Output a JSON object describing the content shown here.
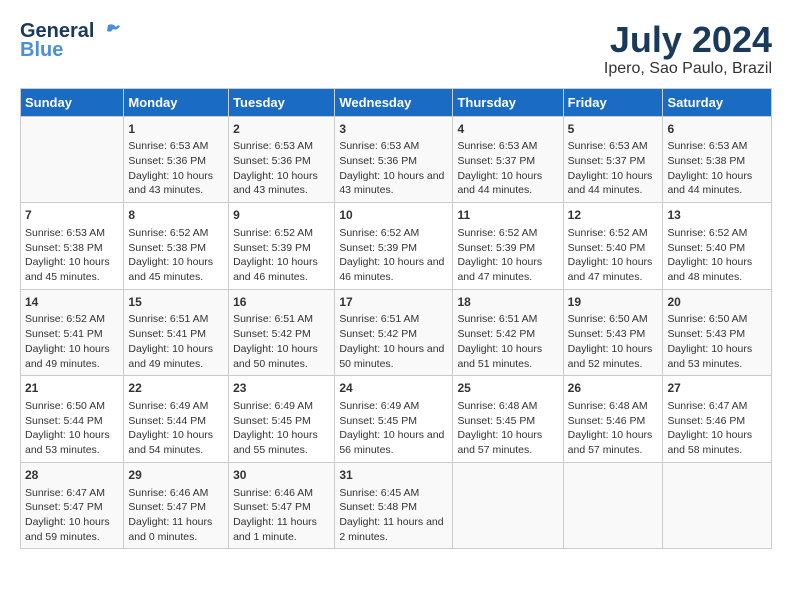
{
  "header": {
    "logo_general": "General",
    "logo_blue": "Blue",
    "month_year": "July 2024",
    "location": "Ipero, Sao Paulo, Brazil"
  },
  "days_of_week": [
    "Sunday",
    "Monday",
    "Tuesday",
    "Wednesday",
    "Thursday",
    "Friday",
    "Saturday"
  ],
  "weeks": [
    [
      {
        "day": "",
        "sunrise": "",
        "sunset": "",
        "daylight": ""
      },
      {
        "day": "1",
        "sunrise": "Sunrise: 6:53 AM",
        "sunset": "Sunset: 5:36 PM",
        "daylight": "Daylight: 10 hours and 43 minutes."
      },
      {
        "day": "2",
        "sunrise": "Sunrise: 6:53 AM",
        "sunset": "Sunset: 5:36 PM",
        "daylight": "Daylight: 10 hours and 43 minutes."
      },
      {
        "day": "3",
        "sunrise": "Sunrise: 6:53 AM",
        "sunset": "Sunset: 5:36 PM",
        "daylight": "Daylight: 10 hours and 43 minutes."
      },
      {
        "day": "4",
        "sunrise": "Sunrise: 6:53 AM",
        "sunset": "Sunset: 5:37 PM",
        "daylight": "Daylight: 10 hours and 44 minutes."
      },
      {
        "day": "5",
        "sunrise": "Sunrise: 6:53 AM",
        "sunset": "Sunset: 5:37 PM",
        "daylight": "Daylight: 10 hours and 44 minutes."
      },
      {
        "day": "6",
        "sunrise": "Sunrise: 6:53 AM",
        "sunset": "Sunset: 5:38 PM",
        "daylight": "Daylight: 10 hours and 44 minutes."
      }
    ],
    [
      {
        "day": "7",
        "sunrise": "Sunrise: 6:53 AM",
        "sunset": "Sunset: 5:38 PM",
        "daylight": "Daylight: 10 hours and 45 minutes."
      },
      {
        "day": "8",
        "sunrise": "Sunrise: 6:52 AM",
        "sunset": "Sunset: 5:38 PM",
        "daylight": "Daylight: 10 hours and 45 minutes."
      },
      {
        "day": "9",
        "sunrise": "Sunrise: 6:52 AM",
        "sunset": "Sunset: 5:39 PM",
        "daylight": "Daylight: 10 hours and 46 minutes."
      },
      {
        "day": "10",
        "sunrise": "Sunrise: 6:52 AM",
        "sunset": "Sunset: 5:39 PM",
        "daylight": "Daylight: 10 hours and 46 minutes."
      },
      {
        "day": "11",
        "sunrise": "Sunrise: 6:52 AM",
        "sunset": "Sunset: 5:39 PM",
        "daylight": "Daylight: 10 hours and 47 minutes."
      },
      {
        "day": "12",
        "sunrise": "Sunrise: 6:52 AM",
        "sunset": "Sunset: 5:40 PM",
        "daylight": "Daylight: 10 hours and 47 minutes."
      },
      {
        "day": "13",
        "sunrise": "Sunrise: 6:52 AM",
        "sunset": "Sunset: 5:40 PM",
        "daylight": "Daylight: 10 hours and 48 minutes."
      }
    ],
    [
      {
        "day": "14",
        "sunrise": "Sunrise: 6:52 AM",
        "sunset": "Sunset: 5:41 PM",
        "daylight": "Daylight: 10 hours and 49 minutes."
      },
      {
        "day": "15",
        "sunrise": "Sunrise: 6:51 AM",
        "sunset": "Sunset: 5:41 PM",
        "daylight": "Daylight: 10 hours and 49 minutes."
      },
      {
        "day": "16",
        "sunrise": "Sunrise: 6:51 AM",
        "sunset": "Sunset: 5:42 PM",
        "daylight": "Daylight: 10 hours and 50 minutes."
      },
      {
        "day": "17",
        "sunrise": "Sunrise: 6:51 AM",
        "sunset": "Sunset: 5:42 PM",
        "daylight": "Daylight: 10 hours and 50 minutes."
      },
      {
        "day": "18",
        "sunrise": "Sunrise: 6:51 AM",
        "sunset": "Sunset: 5:42 PM",
        "daylight": "Daylight: 10 hours and 51 minutes."
      },
      {
        "day": "19",
        "sunrise": "Sunrise: 6:50 AM",
        "sunset": "Sunset: 5:43 PM",
        "daylight": "Daylight: 10 hours and 52 minutes."
      },
      {
        "day": "20",
        "sunrise": "Sunrise: 6:50 AM",
        "sunset": "Sunset: 5:43 PM",
        "daylight": "Daylight: 10 hours and 53 minutes."
      }
    ],
    [
      {
        "day": "21",
        "sunrise": "Sunrise: 6:50 AM",
        "sunset": "Sunset: 5:44 PM",
        "daylight": "Daylight: 10 hours and 53 minutes."
      },
      {
        "day": "22",
        "sunrise": "Sunrise: 6:49 AM",
        "sunset": "Sunset: 5:44 PM",
        "daylight": "Daylight: 10 hours and 54 minutes."
      },
      {
        "day": "23",
        "sunrise": "Sunrise: 6:49 AM",
        "sunset": "Sunset: 5:45 PM",
        "daylight": "Daylight: 10 hours and 55 minutes."
      },
      {
        "day": "24",
        "sunrise": "Sunrise: 6:49 AM",
        "sunset": "Sunset: 5:45 PM",
        "daylight": "Daylight: 10 hours and 56 minutes."
      },
      {
        "day": "25",
        "sunrise": "Sunrise: 6:48 AM",
        "sunset": "Sunset: 5:45 PM",
        "daylight": "Daylight: 10 hours and 57 minutes."
      },
      {
        "day": "26",
        "sunrise": "Sunrise: 6:48 AM",
        "sunset": "Sunset: 5:46 PM",
        "daylight": "Daylight: 10 hours and 57 minutes."
      },
      {
        "day": "27",
        "sunrise": "Sunrise: 6:47 AM",
        "sunset": "Sunset: 5:46 PM",
        "daylight": "Daylight: 10 hours and 58 minutes."
      }
    ],
    [
      {
        "day": "28",
        "sunrise": "Sunrise: 6:47 AM",
        "sunset": "Sunset: 5:47 PM",
        "daylight": "Daylight: 10 hours and 59 minutes."
      },
      {
        "day": "29",
        "sunrise": "Sunrise: 6:46 AM",
        "sunset": "Sunset: 5:47 PM",
        "daylight": "Daylight: 11 hours and 0 minutes."
      },
      {
        "day": "30",
        "sunrise": "Sunrise: 6:46 AM",
        "sunset": "Sunset: 5:47 PM",
        "daylight": "Daylight: 11 hours and 1 minute."
      },
      {
        "day": "31",
        "sunrise": "Sunrise: 6:45 AM",
        "sunset": "Sunset: 5:48 PM",
        "daylight": "Daylight: 11 hours and 2 minutes."
      },
      {
        "day": "",
        "sunrise": "",
        "sunset": "",
        "daylight": ""
      },
      {
        "day": "",
        "sunrise": "",
        "sunset": "",
        "daylight": ""
      },
      {
        "day": "",
        "sunrise": "",
        "sunset": "",
        "daylight": ""
      }
    ]
  ]
}
